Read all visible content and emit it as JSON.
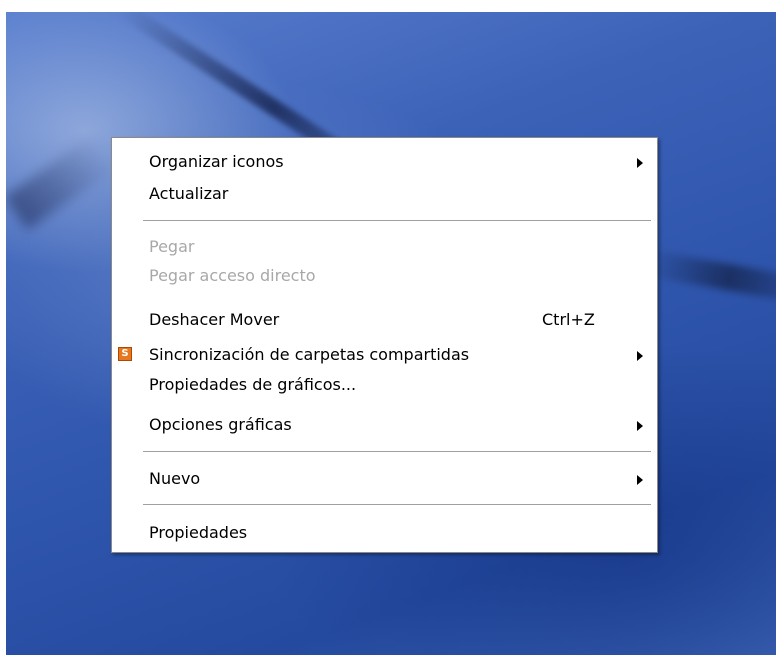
{
  "context_menu": {
    "items": [
      {
        "label": "Organizar iconos",
        "shortcut": "",
        "submenu": true,
        "enabled": true
      },
      {
        "label": "Actualizar",
        "shortcut": "",
        "submenu": false,
        "enabled": true
      },
      {
        "label": "Pegar",
        "shortcut": "",
        "submenu": false,
        "enabled": false
      },
      {
        "label": "Pegar acceso directo",
        "shortcut": "",
        "submenu": false,
        "enabled": false
      },
      {
        "label": "Deshacer Mover",
        "shortcut": "Ctrl+Z",
        "submenu": false,
        "enabled": true
      },
      {
        "label": "Sincronización de carpetas compartidas",
        "shortcut": "",
        "submenu": true,
        "enabled": true,
        "icon": "shared-folder-sync-icon",
        "icon_letter": "S"
      },
      {
        "label": "Propiedades de gráficos...",
        "shortcut": "",
        "submenu": false,
        "enabled": true
      },
      {
        "label": "Opciones gráficas",
        "shortcut": "",
        "submenu": true,
        "enabled": true
      },
      {
        "label": "Nuevo",
        "shortcut": "",
        "submenu": true,
        "enabled": true
      },
      {
        "label": "Propiedades",
        "shortcut": "",
        "submenu": false,
        "enabled": true
      }
    ]
  },
  "colors": {
    "menu_background": "#ffffff",
    "text": "#000000",
    "disabled_text": "#a8a8a8",
    "separator": "#a0a0a0",
    "desktop_blue": "#2f56ad",
    "icon_orange": "#e8771e"
  }
}
